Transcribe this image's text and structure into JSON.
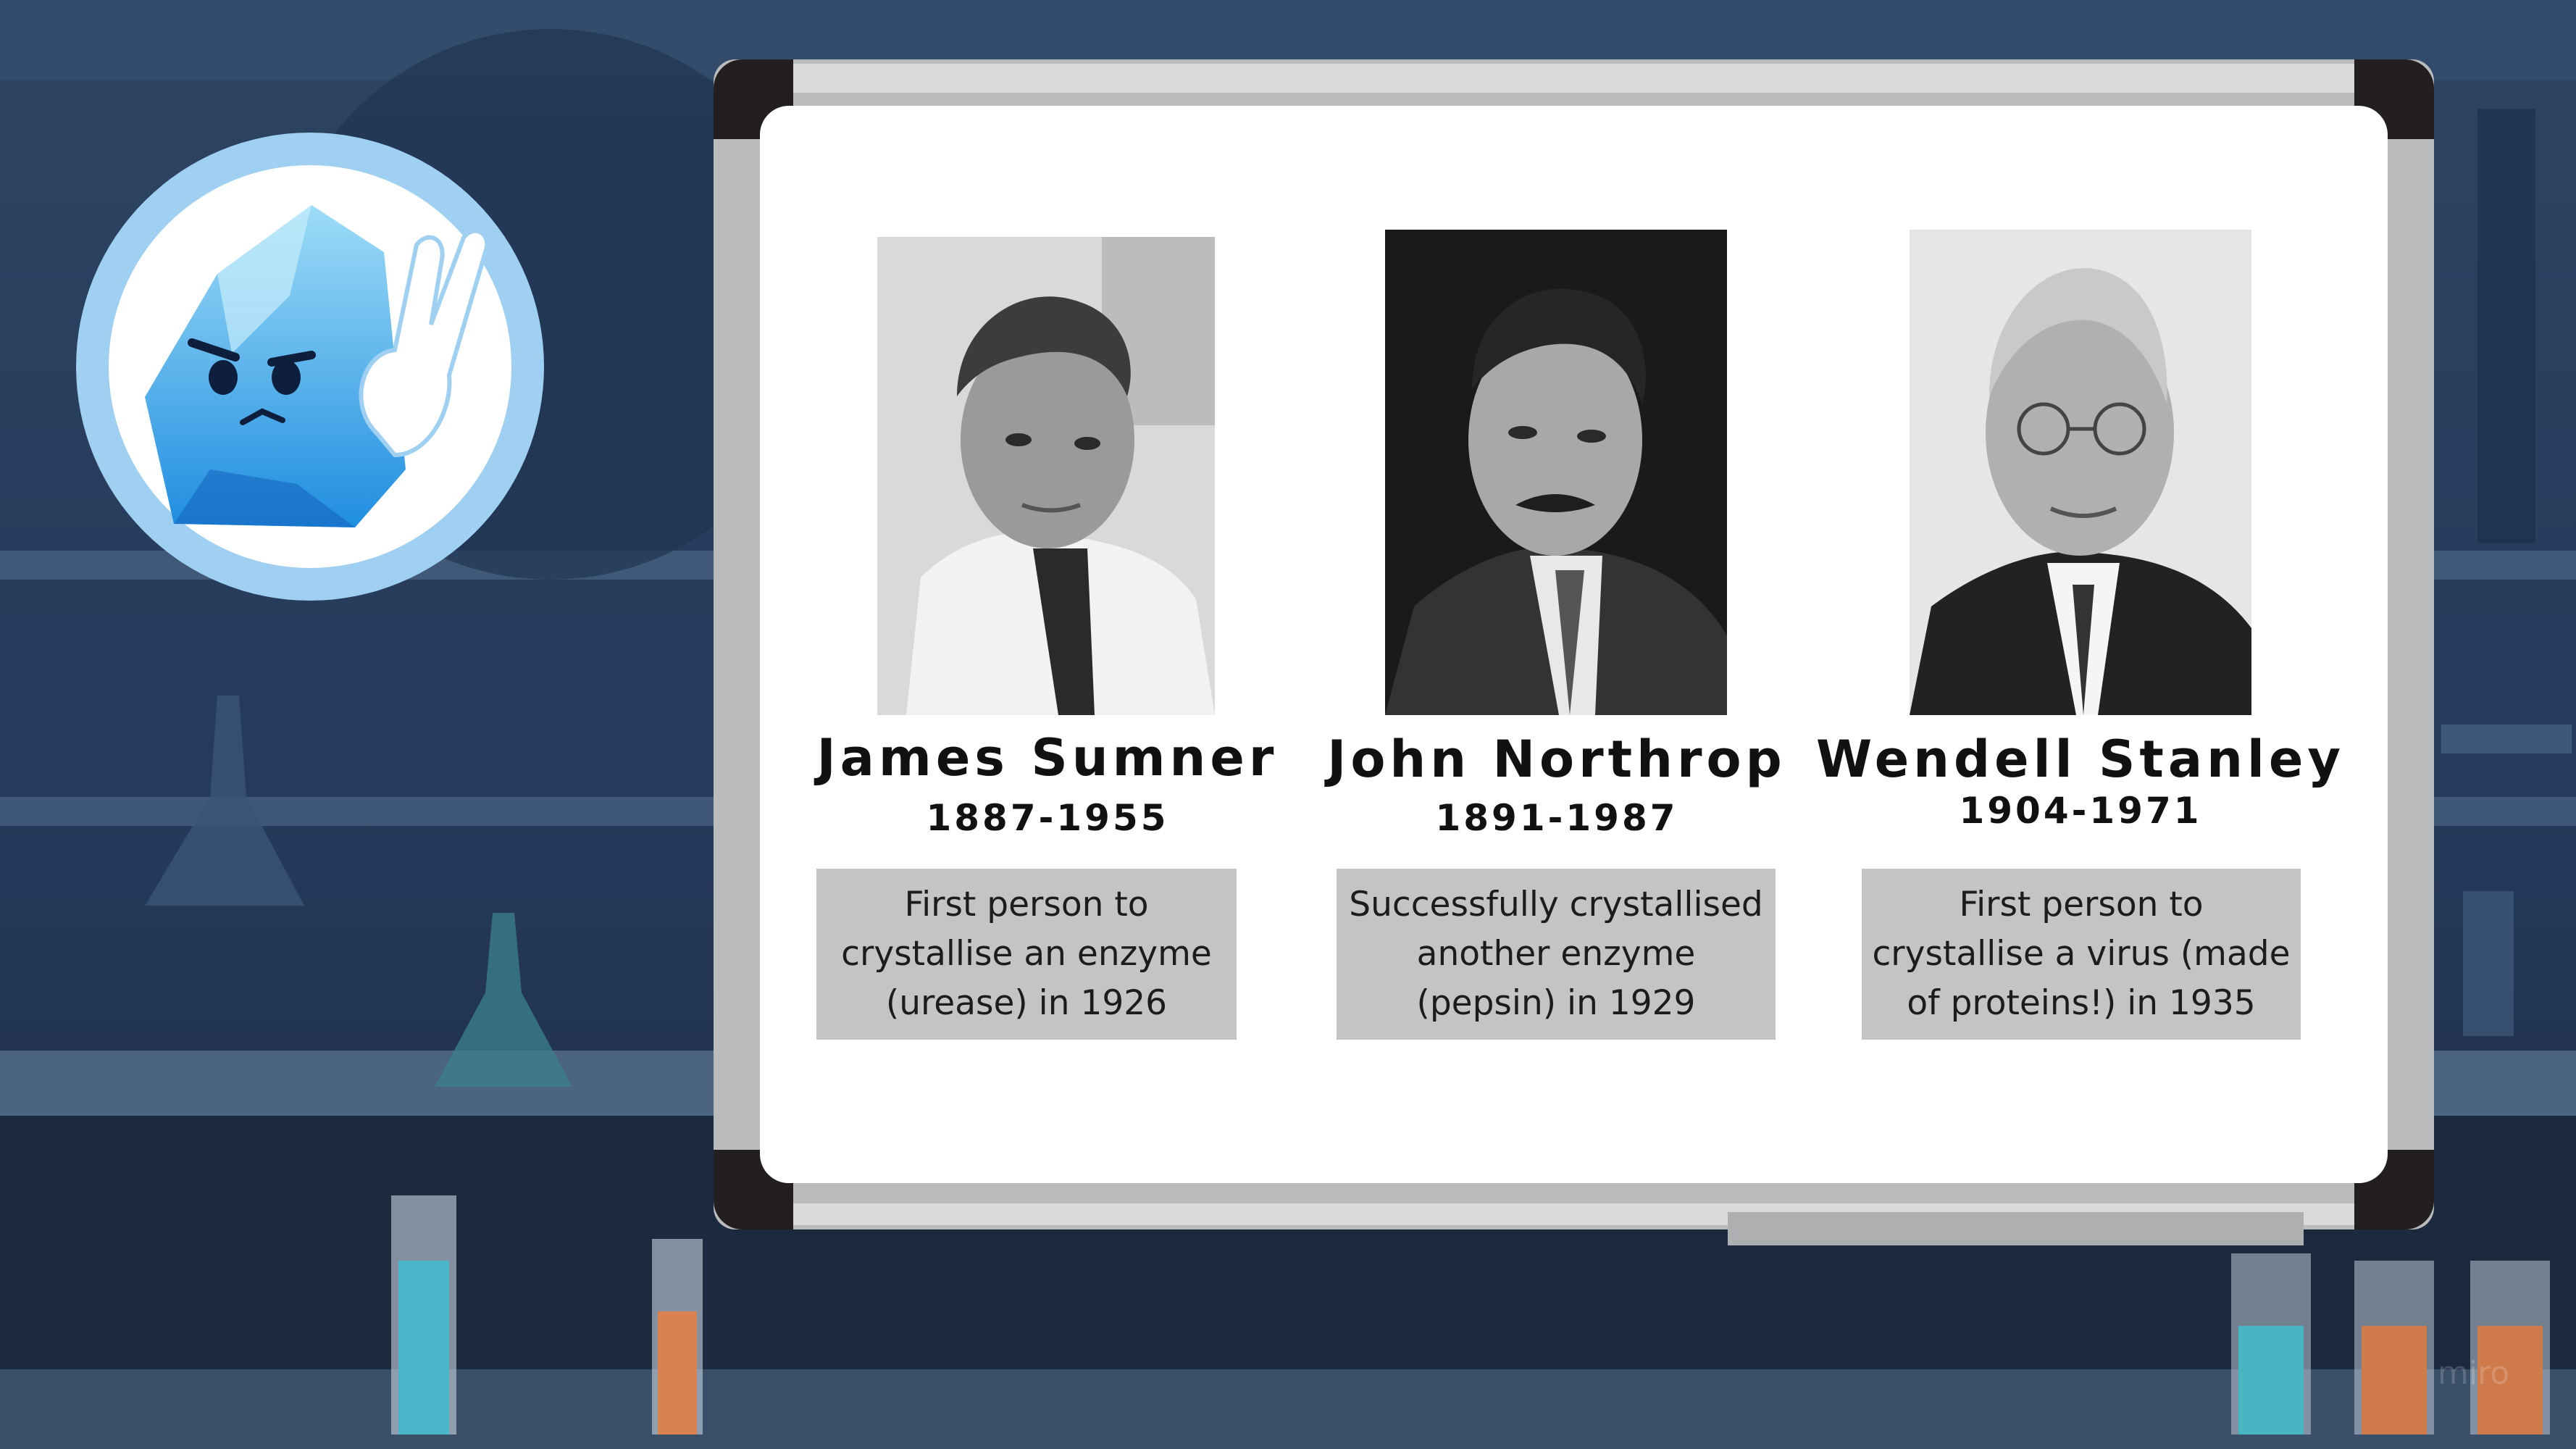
{
  "scientists": [
    {
      "name": "James Sumner",
      "years": "1887-1955",
      "description_lines": [
        "First person to",
        "crystallise an enzyme",
        "(urease) in 1926"
      ]
    },
    {
      "name": "John Northrop",
      "years": "1891-1987",
      "description_lines": [
        "Successfully crystallised",
        "another enzyme",
        "(pepsin) in 1929"
      ]
    },
    {
      "name": "Wendell Stanley",
      "years": "1904-1971",
      "description_lines": [
        "First person to",
        "crystallise a virus (made",
        "of proteins!) in 1935"
      ]
    }
  ],
  "watermark": "miro",
  "colors": {
    "background": "#22344f",
    "board": "#ffffff",
    "caption_box": "#c3c4c6",
    "mascot_ring": "#9fd0f1",
    "mascot_crystal": "#4fb3ee"
  },
  "icons": {
    "mascot": "ice-crystal-mascot-icon"
  }
}
